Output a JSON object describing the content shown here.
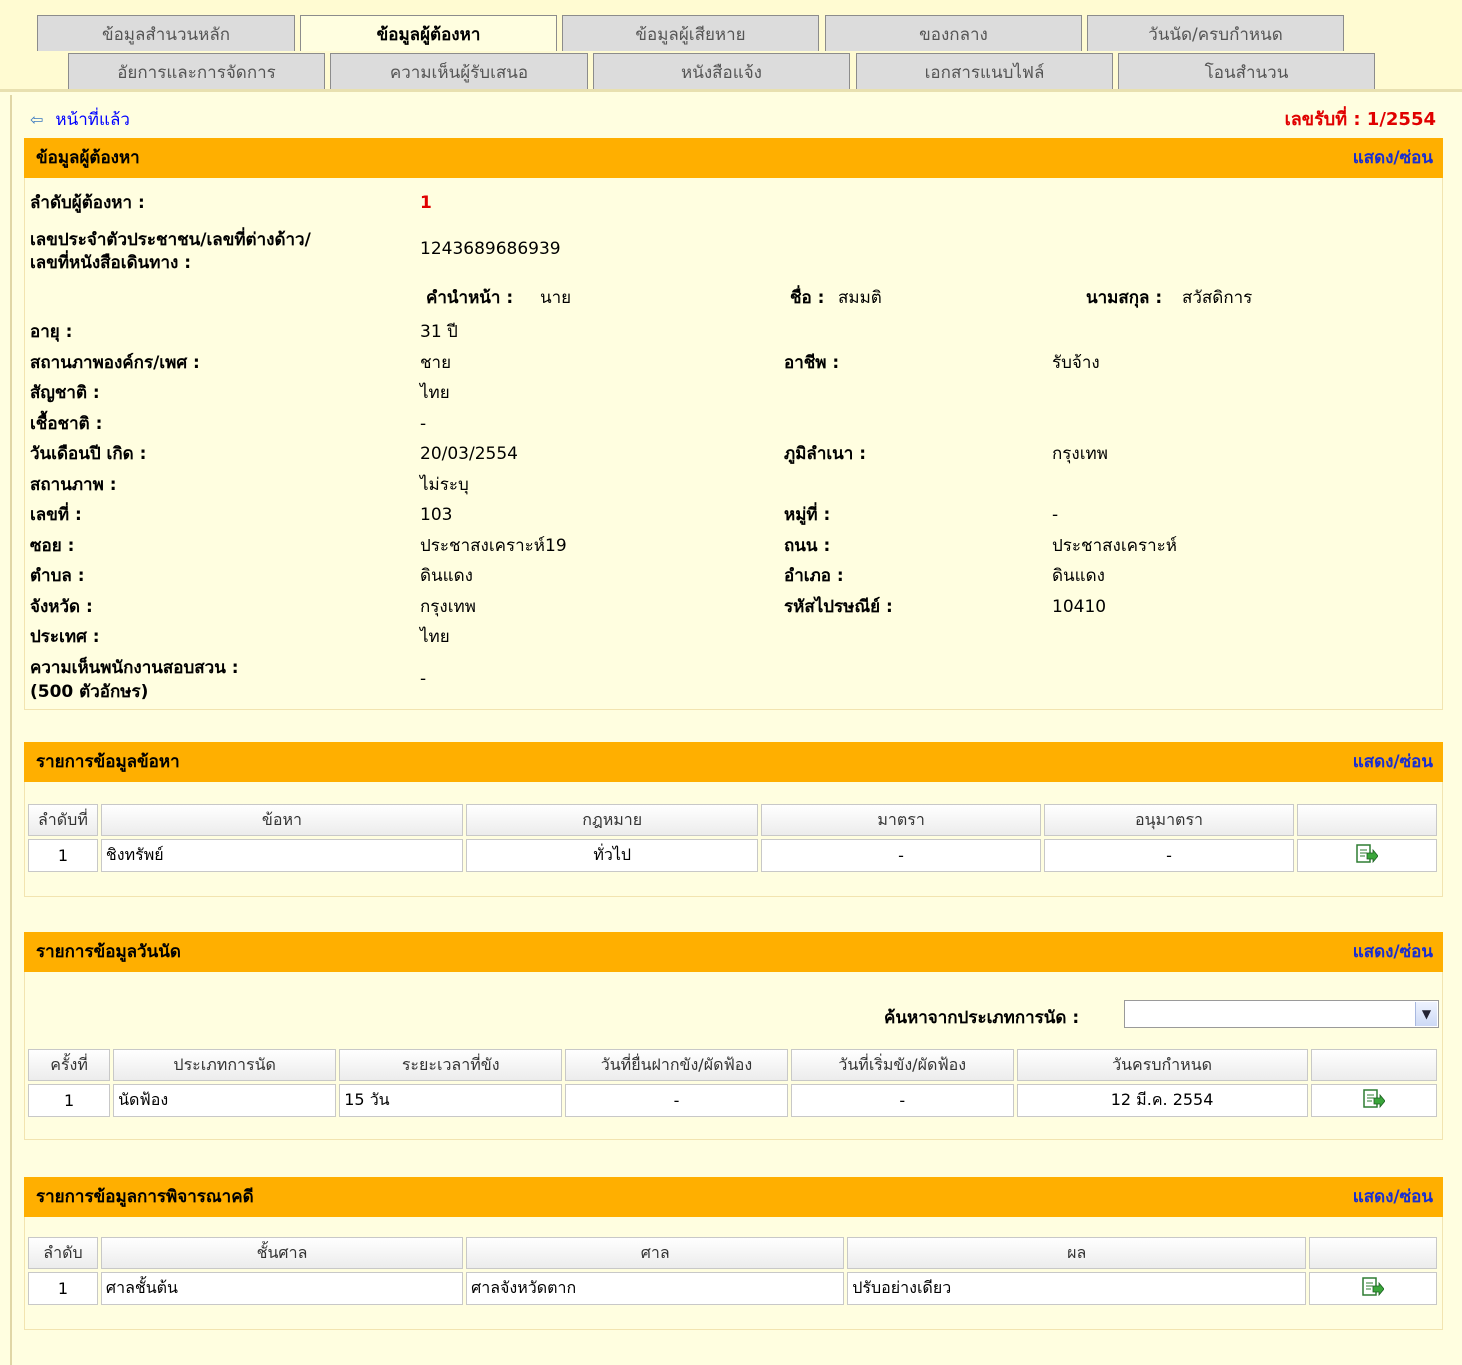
{
  "tabs_row1": [
    "ข้อมูลสำนวนหลัก",
    "ข้อมูลผู้ต้องหา",
    "ข้อมูลผู้เสียหาย",
    "ของกลาง",
    "วันนัด/ครบกำหนด"
  ],
  "tabs_row2": [
    "อัยการและการจัดการ",
    "ความเห็นผู้รับเสนอ",
    "หนังสือแจ้ง",
    "เอกสารแนบไฟล์",
    "โอนสำนวน"
  ],
  "active_tab": "ข้อมูลผู้ต้องหา",
  "back_link": "หน้าที่แล้ว",
  "case_number": "เลขรับที่ : 1/2554",
  "toggle_label": "แสดง/ซ่อน",
  "suspect": {
    "title": "ข้อมูลผู้ต้องหา",
    "order_label": "ลำดับผู้ต้องหา :",
    "order_value": "1",
    "id_label_1": "เลขประจำตัวประชาชน/เลขที่ต่างด้าว/",
    "id_label_2": "เลขที่หนังสือเดินทาง :",
    "id_value": "1243689686939",
    "prefix_label": "คำนำหน้า :",
    "prefix_value": "นาย",
    "firstname_label": "ชื่อ :",
    "firstname_value": "สมมติ",
    "lastname_label": "นามสกุล :",
    "lastname_value": "สวัสดิการ",
    "age_label": "อายุ :",
    "age_value": "31 ปี",
    "gender_label": "สถานภาพองค์กร/เพศ :",
    "gender_value": "ชาย",
    "occupation_label": "อาชีพ :",
    "occupation_value": "รับจ้าง",
    "nationality_label": "สัญชาติ :",
    "nationality_value": "ไทย",
    "race_label": "เชื้อชาติ :",
    "race_value": "-",
    "birthdate_label": "วันเดือนปี เกิด :",
    "birthdate_value": "20/03/2554",
    "hometown_label": "ภูมิลำเนา :",
    "hometown_value": "กรุงเทพ",
    "status_label": "สถานภาพ :",
    "status_value": "ไม่ระบุ",
    "house_no_label": "เลขที่ :",
    "house_no_value": "103",
    "moo_label": "หมู่ที่ :",
    "moo_value": "-",
    "soi_label": "ซอย :",
    "soi_value": "ประชาสงเคราะห์19",
    "road_label": "ถนน :",
    "road_value": "ประชาสงเคราะห์",
    "subdistrict_label": "ตำบล :",
    "subdistrict_value": "ดินแดง",
    "district_label": "อำเภอ :",
    "district_value": "ดินแดง",
    "province_label": "จังหวัด :",
    "province_value": "กรุงเทพ",
    "postcode_label": "รหัสไปรษณีย์ :",
    "postcode_value": "10410",
    "country_label": "ประเทศ :",
    "country_value": "ไทย",
    "opinion_label_1": "ความเห็นพนักงานสอบสวน :",
    "opinion_label_2": "(500 ตัวอักษร)",
    "opinion_value": "-"
  },
  "charges": {
    "title": "รายการข้อมูลข้อหา",
    "headers": [
      "ลำดับที่",
      "ข้อหา",
      "กฎหมาย",
      "มาตรา",
      "อนุมาตรา"
    ],
    "rows": [
      [
        "1",
        "ชิงทรัพย์",
        "ทั่วไป",
        "-",
        "-"
      ]
    ]
  },
  "appointments": {
    "title": "รายการข้อมูลวันนัด",
    "search_label": "ค้นหาจากประเภทการนัด :",
    "search_value": "",
    "headers": [
      "ครั้งที่",
      "ประเภทการนัด",
      "ระยะเวลาที่ขัง",
      "วันที่ยื่นฝากขัง/ผัดฟ้อง",
      "วันที่เริ่มขัง/ผัดฟ้อง",
      "วันครบกำหนด"
    ],
    "rows": [
      [
        "1",
        "นัดฟ้อง",
        "15 วัน",
        "-",
        "-",
        "12 มี.ค. 2554"
      ]
    ]
  },
  "trials": {
    "title": "รายการข้อมูลการพิจารณาคดี",
    "headers": [
      "ลำดับ",
      "ชั้นศาล",
      "ศาล",
      "ผล"
    ],
    "rows": [
      [
        "1",
        "ศาลชั้นต้น",
        "ศาลจังหวัดตาก",
        "ปรับอย่างเดียว"
      ]
    ]
  },
  "colors": {
    "section_bar": "#ffaf00",
    "background": "#fffee0",
    "accent_red": "#e00000",
    "link_blue": "#1a2fd0"
  },
  "icons": [
    "back-arrow-icon",
    "edit-record-icon",
    "dropdown-arrow-icon"
  ]
}
